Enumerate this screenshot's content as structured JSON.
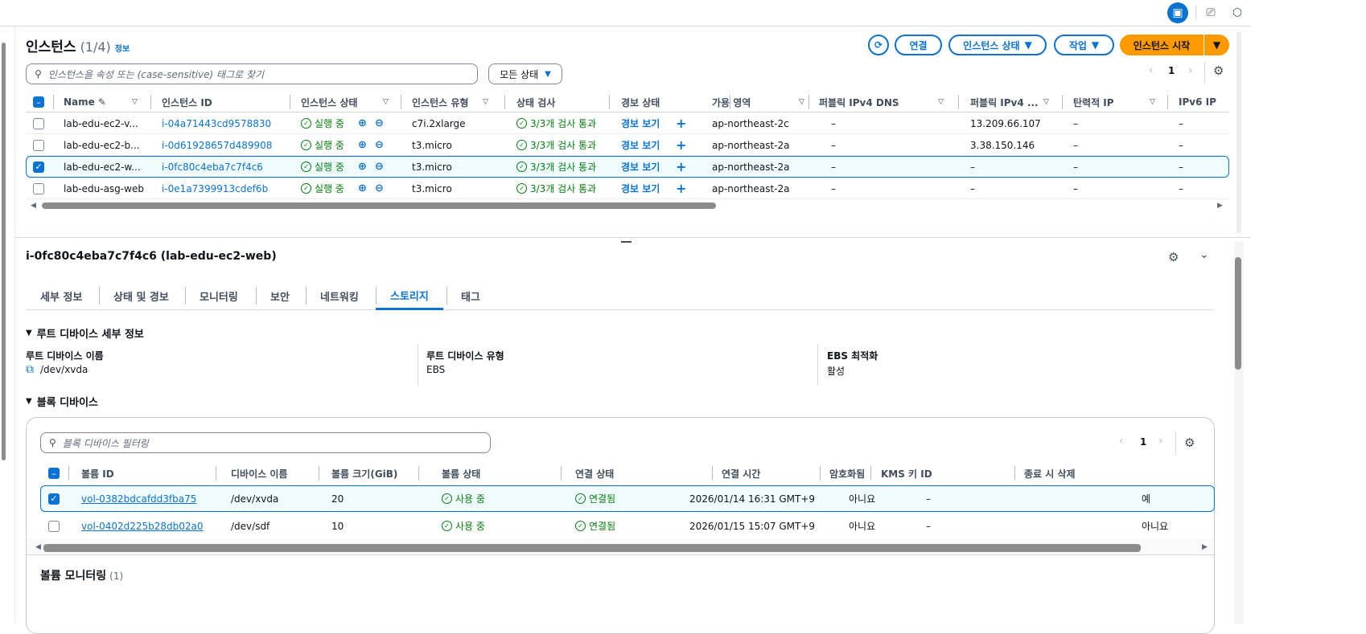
{
  "instances_panel": {
    "title": "인스턴스",
    "count": "(1/4)",
    "info": "정보",
    "refresh_icon": "refresh-icon",
    "buttons": {
      "connect": "연결",
      "instance_state": "인스턴스 상태",
      "actions": "작업",
      "launch": "인스턴스 시작"
    },
    "search_placeholder": "인스턴스을 속성 또는 (case-sensitive) 태그로 찾기",
    "state_filter": "모든 상태",
    "page": "1",
    "columns": [
      "Name",
      "인스턴스 ID",
      "인스턴스 상태",
      "인스턴스 유형",
      "상태 검사",
      "경보 상태",
      "가용 영역",
      "퍼블릭 IPv4 DNS",
      "퍼블릭 IPv4 ...",
      "탄력적 IP",
      "IPv6 IP"
    ],
    "rows": [
      {
        "name": "lab-edu-ec2-v...",
        "id": "i-04a71443cd9578830",
        "state": "실행 중",
        "type": "c7i.2xlarge",
        "check": "3/3개 검사 통과",
        "alarm": "경보 보기",
        "az": "ap-northeast-2c",
        "dns": "–",
        "ipv4": "13.209.66.107",
        "eip": "–",
        "ipv6": "–",
        "selected": false
      },
      {
        "name": "lab-edu-ec2-b...",
        "id": "i-0d61928657d489908",
        "state": "실행 중",
        "type": "t3.micro",
        "check": "3/3개 검사 통과",
        "alarm": "경보 보기",
        "az": "ap-northeast-2a",
        "dns": "–",
        "ipv4": "3.38.150.146",
        "eip": "–",
        "ipv6": "–",
        "selected": false
      },
      {
        "name": "lab-edu-ec2-w...",
        "id": "i-0fc80c4eba7c7f4c6",
        "state": "실행 중",
        "type": "t3.micro",
        "check": "3/3개 검사 통과",
        "alarm": "경보 보기",
        "az": "ap-northeast-2a",
        "dns": "–",
        "ipv4": "–",
        "eip": "–",
        "ipv6": "–",
        "selected": true
      },
      {
        "name": "lab-edu-asg-web",
        "id": "i-0e1a7399913cdef6b",
        "state": "실행 중",
        "type": "t3.micro",
        "check": "3/3개 검사 통과",
        "alarm": "경보 보기",
        "az": "ap-northeast-2a",
        "dns": "–",
        "ipv4": "–",
        "eip": "–",
        "ipv6": "–",
        "selected": false
      }
    ]
  },
  "detail": {
    "title": "i-0fc80c4eba7c7f4c6 (lab-edu-ec2-web)",
    "tabs": [
      "세부 정보",
      "상태 및 경보",
      "모니터링",
      "보안",
      "네트워킹",
      "스토리지",
      "태그"
    ],
    "active_tab": "스토리지",
    "root_section": "루트 디바이스 세부 정보",
    "root_name_label": "루트 디바이스 이름",
    "root_name": "/dev/xvda",
    "root_type_label": "루트 디바이스 유형",
    "root_type": "EBS",
    "ebs_opt_label": "EBS 최적화",
    "ebs_opt": "활성",
    "block_section": "블록 디바이스",
    "block_filter_placeholder": "블록 디바이스 필터링",
    "block_page": "1",
    "block_columns": [
      "볼륨 ID",
      "디바이스 이름",
      "볼륨 크기(GiB)",
      "볼륨 상태",
      "연결 상태",
      "연결 시간",
      "암호화됨",
      "KMS 키 ID",
      "종료 시 삭제"
    ],
    "volumes": [
      {
        "id": "vol-0382bdcafdd3fba75",
        "device": "/dev/xvda",
        "size": "20",
        "state": "사용 중",
        "attach": "연결됨",
        "time": "2026/01/14 16:31 GMT+9",
        "encrypted": "아니요",
        "kms": "–",
        "delete": "예",
        "selected": true
      },
      {
        "id": "vol-0402d225b28db02a0",
        "device": "/dev/sdf",
        "size": "10",
        "state": "사용 중",
        "attach": "연결됨",
        "time": "2026/01/15 15:07 GMT+9",
        "encrypted": "아니요",
        "kms": "–",
        "delete": "아니요",
        "selected": false
      }
    ],
    "monitoring_section": "볼륨 모니터링",
    "monitoring_count": "(1)"
  },
  "colors": {
    "accent": "#0972d3",
    "primary": "#ff9900",
    "success": "#037f0c"
  }
}
